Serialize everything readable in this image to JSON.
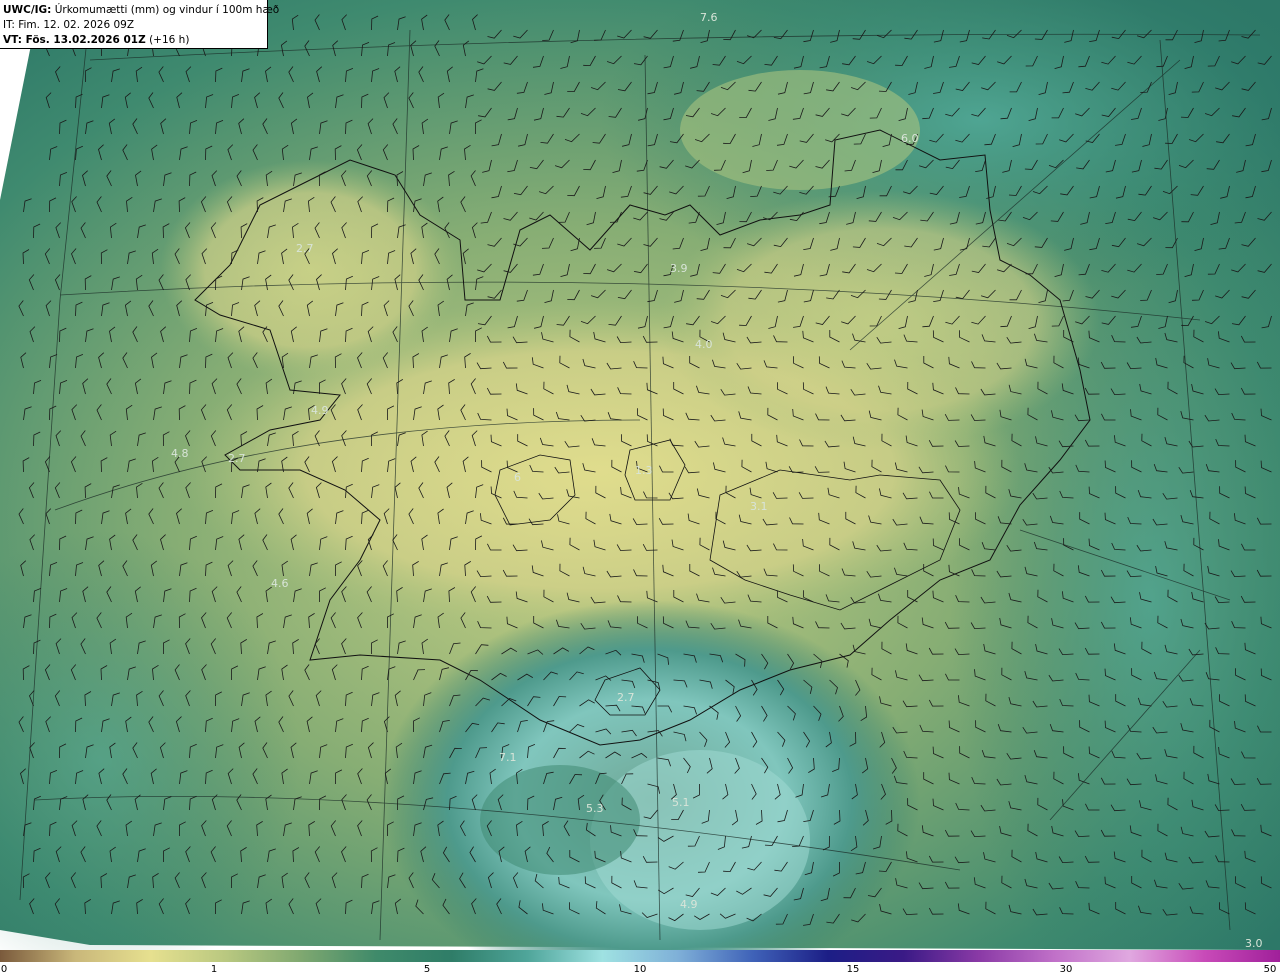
{
  "header": {
    "line1_bold": "UWC/IG:",
    "line1_rest": " Úrkomumætti (mm) og vindur í 100m hæð",
    "line2": "IT: Fim. 12. 02. 2026 09Z",
    "line3_bold": "VT: Fös. 13.02.2026 01Z",
    "line3_rest": " (+16 h)"
  },
  "map_values": [
    "7.6",
    "6.0",
    "2.7",
    "3.9",
    "4.0",
    "4.9",
    "4.8",
    "2.7",
    "6",
    "1.3",
    "3.1",
    "4.6",
    "2.7",
    "7.1",
    "5.3",
    "5.1",
    "4.9",
    "3.0"
  ],
  "colorbar": {
    "ticks": [
      "0",
      "1",
      "5",
      "10",
      "15",
      "30",
      "50"
    ],
    "colors": [
      "#7a5a3c",
      "#c9b77a",
      "#e6e08f",
      "#b9c880",
      "#7fa870",
      "#3f8a6a",
      "#2f7d68",
      "#4fa59a",
      "#9fe2e2",
      "#7fb0d8",
      "#3f62b8",
      "#1c1e86",
      "#3a1a86",
      "#8a3aa6",
      "#c070c8",
      "#e0a8e0",
      "#c84ab8",
      "#a0209a"
    ]
  }
}
